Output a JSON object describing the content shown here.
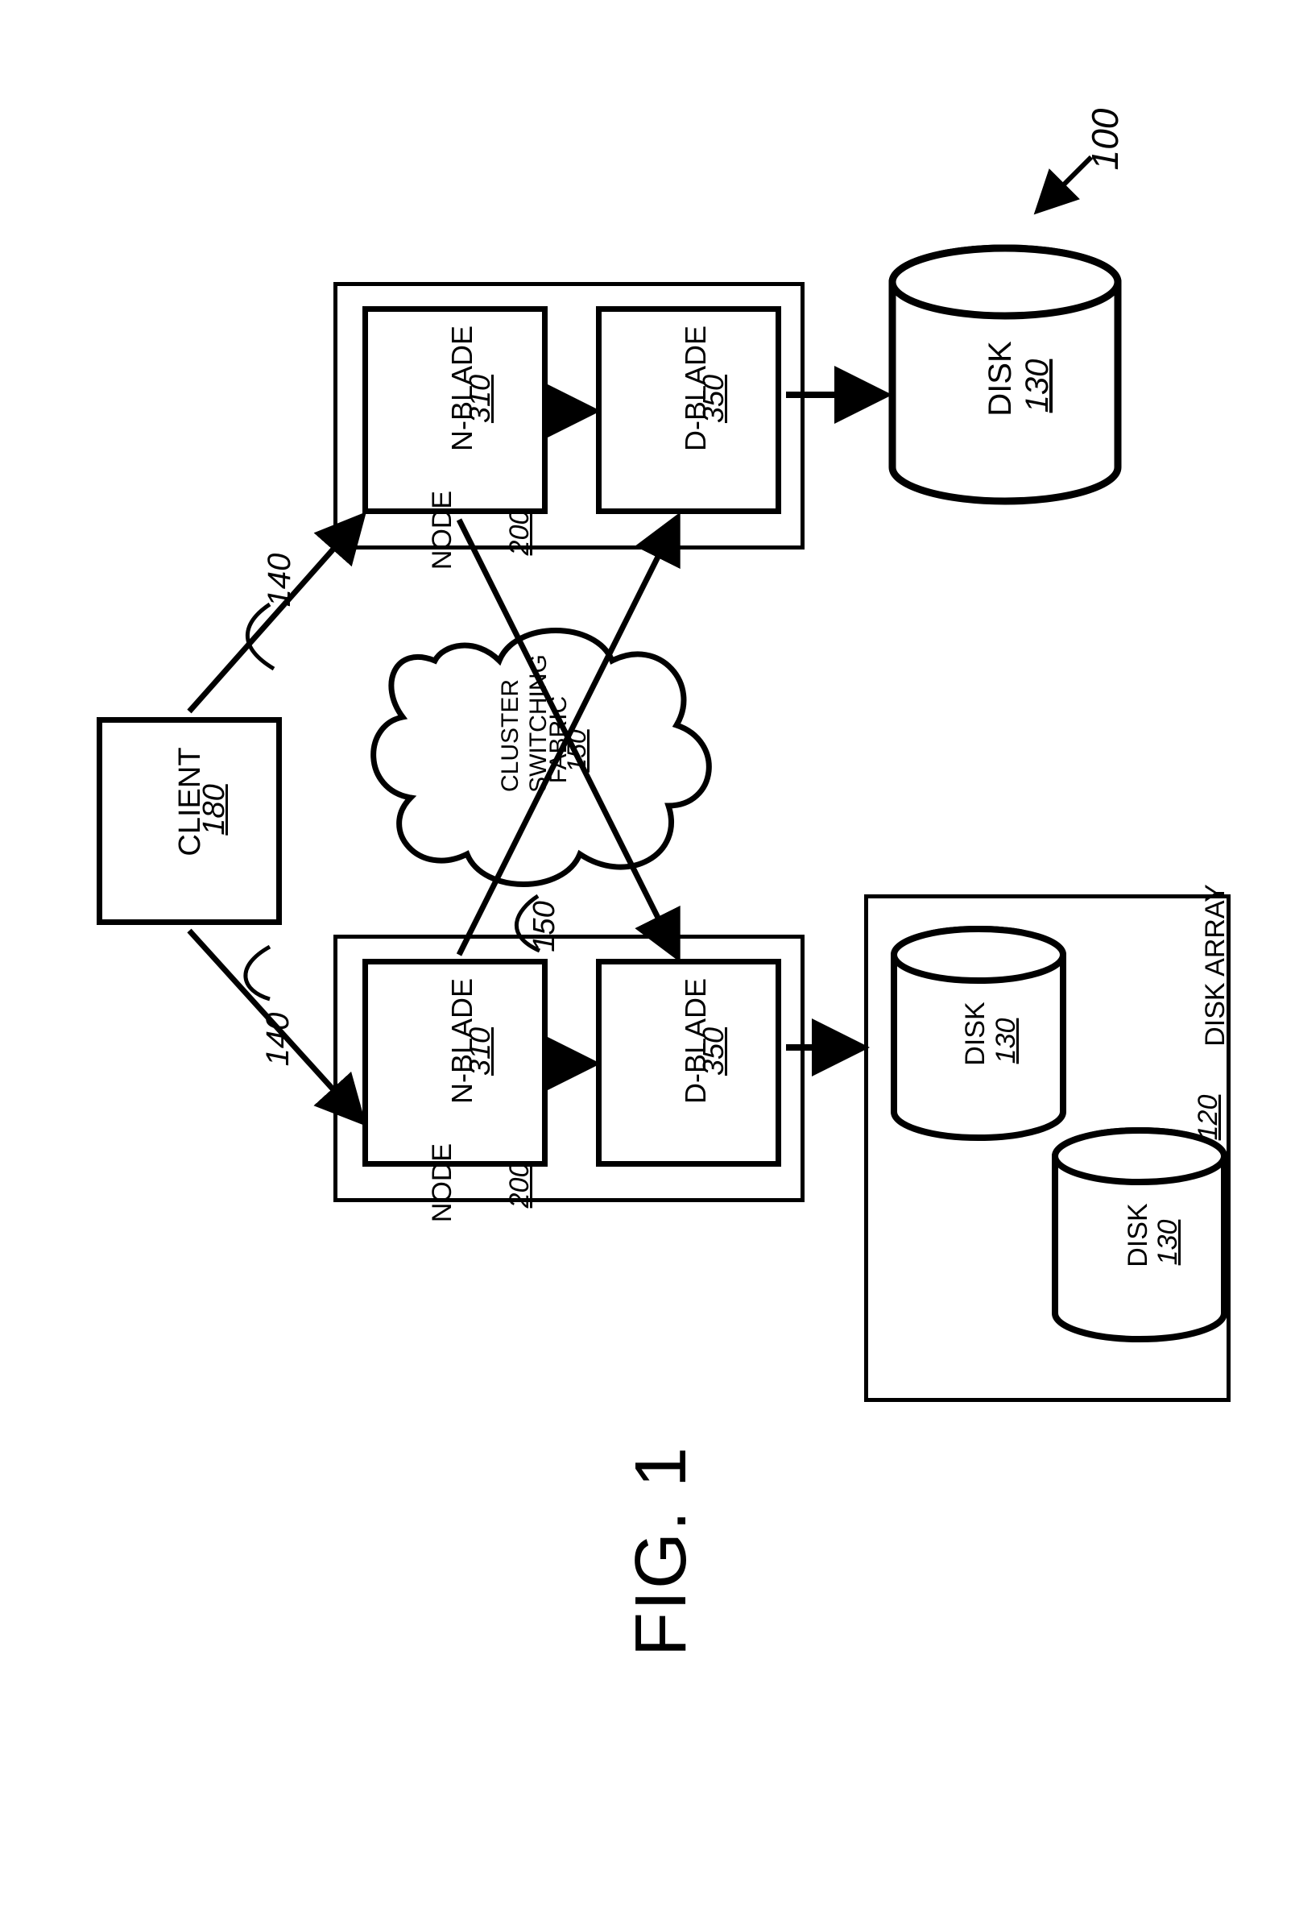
{
  "figure_ref": "100",
  "figure_caption": "FIG. 1",
  "client": {
    "label": "CLIENT",
    "ref": "180"
  },
  "conn_client_nblade_ref": "140",
  "nodes": [
    {
      "node_label": "NODE",
      "node_ref": "200",
      "nblade": {
        "label": "N-BLADE",
        "ref": "310"
      },
      "dblade": {
        "label": "D-BLADE",
        "ref": "350"
      }
    },
    {
      "node_label": "NODE",
      "node_ref": "200",
      "nblade": {
        "label": "N-BLADE",
        "ref": "310"
      },
      "dblade": {
        "label": "D-BLADE",
        "ref": "350"
      }
    }
  ],
  "fabric": {
    "line1": "CLUSTER",
    "line2": "SWITCHING",
    "line3": "FABRIC",
    "ref": "150"
  },
  "fabric_conn_ref": "150",
  "disk_top": {
    "label": "DISK",
    "ref": "130"
  },
  "disk_array": {
    "label": "DISK ARRAY",
    "ref": "120",
    "disks": [
      {
        "label": "DISK",
        "ref": "130"
      },
      {
        "label": "DISK",
        "ref": "130"
      }
    ]
  }
}
